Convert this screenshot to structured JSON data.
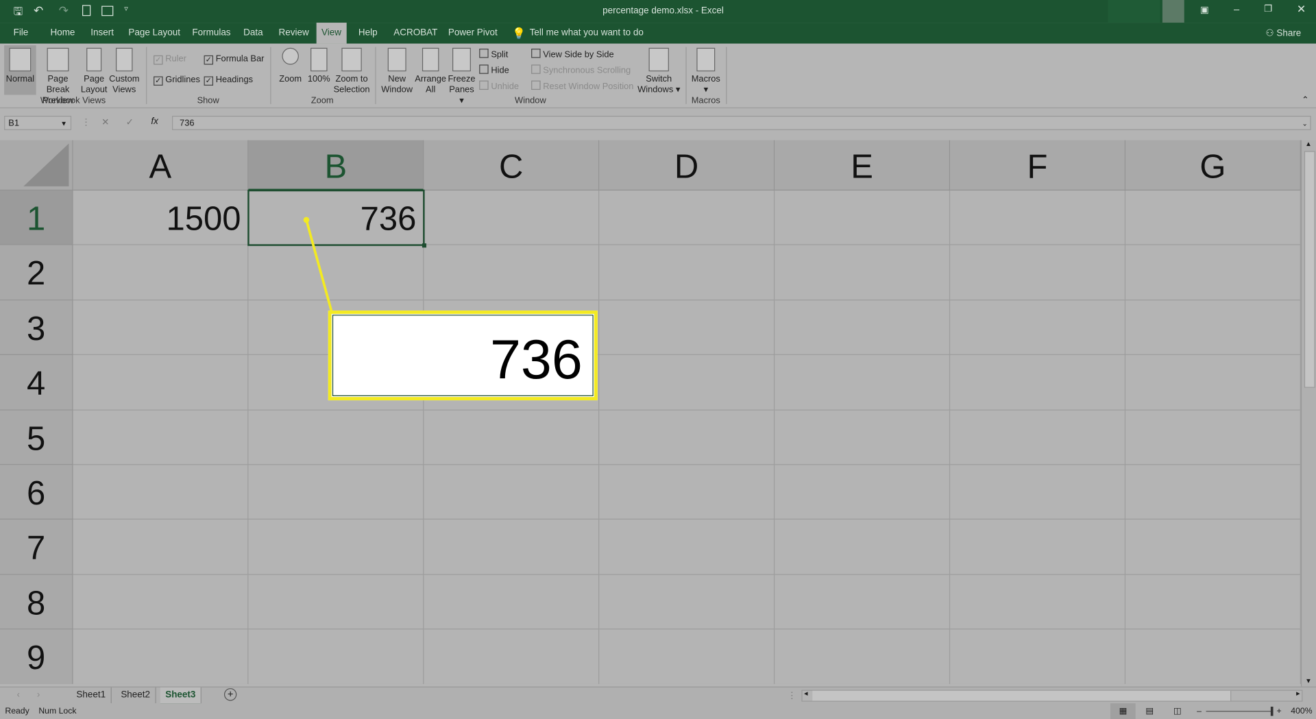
{
  "titlebar": {
    "title": "percentage demo.xlsx  -  Excel",
    "qat": [
      "save-icon",
      "undo-icon",
      "redo-icon",
      "new-file-icon",
      "form-icon",
      "customize-qat-icon"
    ]
  },
  "tabs": [
    "File",
    "Home",
    "Insert",
    "Page Layout",
    "Formulas",
    "Data",
    "Review",
    "View",
    "Help",
    "ACROBAT",
    "Power Pivot"
  ],
  "active_tab": "View",
  "tell_me": "Tell me what you want to do",
  "share": "Share",
  "ribbon": {
    "workbook_views": {
      "label": "Workbook Views",
      "normal": "Normal",
      "page_break": [
        "Page Break",
        "Preview"
      ],
      "page_layout": [
        "Page",
        "Layout"
      ],
      "custom": [
        "Custom",
        "Views"
      ]
    },
    "show": {
      "label": "Show",
      "ruler": "Ruler",
      "formula_bar": "Formula Bar",
      "gridlines": "Gridlines",
      "headings": "Headings"
    },
    "zoom": {
      "label": "Zoom",
      "zoom": "Zoom",
      "hundred": "100%",
      "selection": [
        "Zoom to",
        "Selection"
      ]
    },
    "window": {
      "label": "Window",
      "new_window": [
        "New",
        "Window"
      ],
      "arrange": [
        "Arrange",
        "All"
      ],
      "freeze": [
        "Freeze",
        "Panes ▾"
      ],
      "split": "Split",
      "hide": "Hide",
      "unhide": "Unhide",
      "side_by_side": "View Side by Side",
      "sync": "Synchronous Scrolling",
      "reset": "Reset Window Position",
      "switch": [
        "Switch",
        "Windows ▾"
      ]
    },
    "macros": {
      "label": "Macros",
      "macros": "Macros",
      "arrow": "▾"
    }
  },
  "formula_bar": {
    "name_box": "B1",
    "value": "736",
    "fx": "fx"
  },
  "columns": [
    "A",
    "B",
    "C",
    "D",
    "E",
    "F",
    "G"
  ],
  "rows": [
    "1",
    "2",
    "3",
    "4",
    "5",
    "6",
    "7",
    "8",
    "9"
  ],
  "cells": {
    "A1": "1500",
    "B1": "736"
  },
  "selected_cell": "B1",
  "callout": {
    "value": "736",
    "color": "#f3ea22"
  },
  "sheets": [
    "Sheet1",
    "Sheet2",
    "Sheet3"
  ],
  "active_sheet": "Sheet3",
  "status": {
    "ready": "Ready",
    "num_lock": "Num Lock",
    "zoom": "400%"
  }
}
